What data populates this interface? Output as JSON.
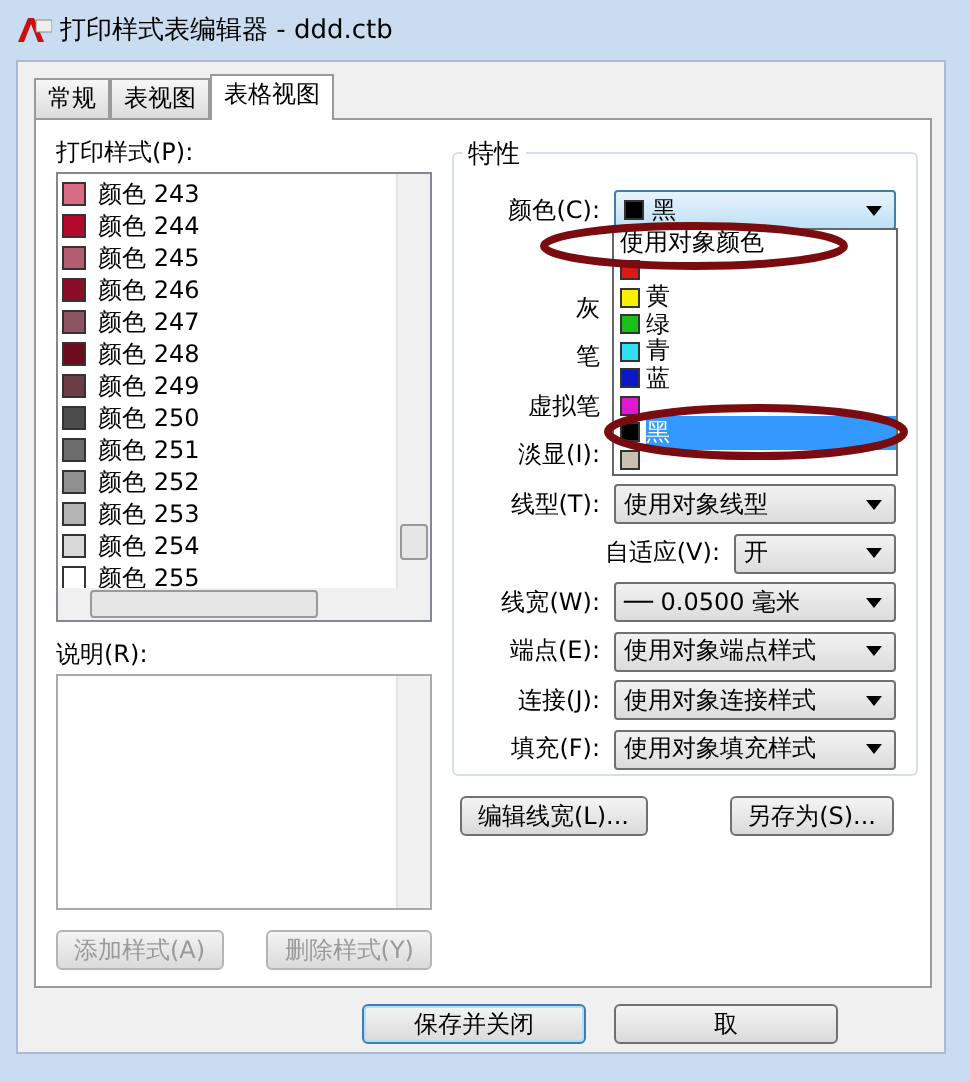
{
  "window": {
    "title": "打印样式表编辑器 - ddd.ctb"
  },
  "tabs": [
    {
      "label": "常规",
      "selected": false
    },
    {
      "label": "表视图",
      "selected": false
    },
    {
      "label": "表格视图",
      "selected": true
    }
  ],
  "styles_list": {
    "label": "打印样式(P):",
    "items": [
      {
        "name": "颜色 243",
        "color": "#d86c84"
      },
      {
        "name": "颜色 244",
        "color": "#b4082c"
      },
      {
        "name": "颜色 245",
        "color": "#b45c70"
      },
      {
        "name": "颜色 246",
        "color": "#8c0c28"
      },
      {
        "name": "颜色 247",
        "color": "#8c5462"
      },
      {
        "name": "颜色 248",
        "color": "#6c0c1c"
      },
      {
        "name": "颜色 249",
        "color": "#6c3c46"
      },
      {
        "name": "颜色 250",
        "color": "#4c4c4c"
      },
      {
        "name": "颜色 251",
        "color": "#6c6c6c"
      },
      {
        "name": "颜色 252",
        "color": "#909090"
      },
      {
        "name": "颜色 253",
        "color": "#b4b4b4"
      },
      {
        "name": "颜色 254",
        "color": "#d8d8d8"
      },
      {
        "name": "颜色 255",
        "color": "#ffffff"
      }
    ]
  },
  "description": {
    "label": "说明(R):"
  },
  "style_buttons": [
    {
      "label": "添加样式(A)",
      "disabled": true
    },
    {
      "label": "删除样式(Y)",
      "disabled": true
    }
  ],
  "properties": {
    "title": "特性",
    "rows": [
      {
        "kind": "color-combo",
        "label": "颜色(C):",
        "value": "黑",
        "color": "#000000"
      },
      {
        "kind": "hidden"
      },
      {
        "kind": "hidden",
        "label": "灰"
      },
      {
        "kind": "hidden",
        "label": "笔"
      },
      {
        "kind": "hidden",
        "label": "虚拟笔"
      },
      {
        "kind": "hidden",
        "label": "淡显(I):"
      },
      {
        "kind": "combo",
        "label": "线型(T):",
        "value": "使用对象线型"
      },
      {
        "kind": "short-combo",
        "label": "自适应(V):",
        "value": "开"
      },
      {
        "kind": "combo",
        "label": "线宽(W):",
        "value": "── 0.0500 毫米"
      },
      {
        "kind": "combo",
        "label": "端点(E):",
        "value": "使用对象端点样式"
      },
      {
        "kind": "combo",
        "label": "连接(J):",
        "value": "使用对象连接样式"
      },
      {
        "kind": "combo",
        "label": "填充(F):",
        "value": "使用对象填充样式"
      }
    ]
  },
  "color_dropdown": {
    "items": [
      {
        "label": "使用对象颜色",
        "selected": false
      },
      {
        "color": "#e01818",
        "selected": false
      },
      {
        "label": "黄",
        "color": "#f8f000",
        "selected": false
      },
      {
        "label": "绿",
        "color": "#18c018",
        "selected": false
      },
      {
        "label": "青",
        "color": "#30e0f0",
        "selected": false
      },
      {
        "label": "蓝",
        "color": "#0818c8",
        "selected": false
      },
      {
        "color": "#e018d0",
        "selected": false
      },
      {
        "label": "黑",
        "color": "#000000",
        "selected": true
      },
      {
        "color": "#c8c0b0",
        "selected": false
      }
    ]
  },
  "property_buttons": [
    {
      "label": "编辑线宽(L)..."
    },
    {
      "label": "另存为(S)..."
    }
  ],
  "footer_buttons": [
    {
      "label": "保存并关闭",
      "default": true
    },
    {
      "label": "取",
      "default": false
    }
  ]
}
